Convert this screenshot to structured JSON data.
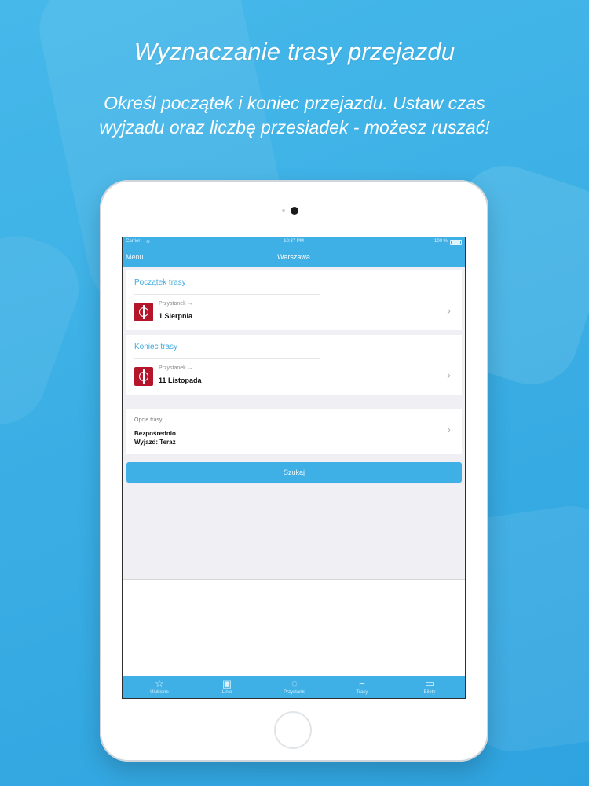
{
  "promo": {
    "headline": "Wyznaczanie trasy przejazdu",
    "subline_1": "Określ początek i koniec przejazdu. Ustaw czas",
    "subline_2": "wyjzadu oraz liczbę przesiadek - możesz ruszać!"
  },
  "statusbar": {
    "carrier": "Carrier",
    "time": "10:37 PM",
    "battery": "100 %"
  },
  "navbar": {
    "menu_label": "Menu",
    "title": "Warszawa"
  },
  "start": {
    "section_title": "Początek trasy",
    "stop_type": "Przystanek →",
    "stop_name": "1 Sierpnia"
  },
  "end": {
    "section_title": "Koniec trasy",
    "stop_type": "Przystanek →",
    "stop_name": "11 Listopada"
  },
  "options": {
    "label": "Opcje trasy",
    "line_1": "Bezpośrednio",
    "line_2": "Wyjazd: Teraz"
  },
  "search_label": "Szukaj",
  "tabs": [
    {
      "label": "Ulubione",
      "icon": "star-icon"
    },
    {
      "label": "Linie",
      "icon": "bus-icon"
    },
    {
      "label": "Przystanki",
      "icon": "stop-pin-icon"
    },
    {
      "label": "Trasy",
      "icon": "route-icon"
    },
    {
      "label": "Bilety",
      "icon": "ticket-icon"
    }
  ],
  "colors": {
    "accent": "#3fb0e6",
    "stop_icon": "#b5152b",
    "section_title": "#3fa9dd"
  }
}
